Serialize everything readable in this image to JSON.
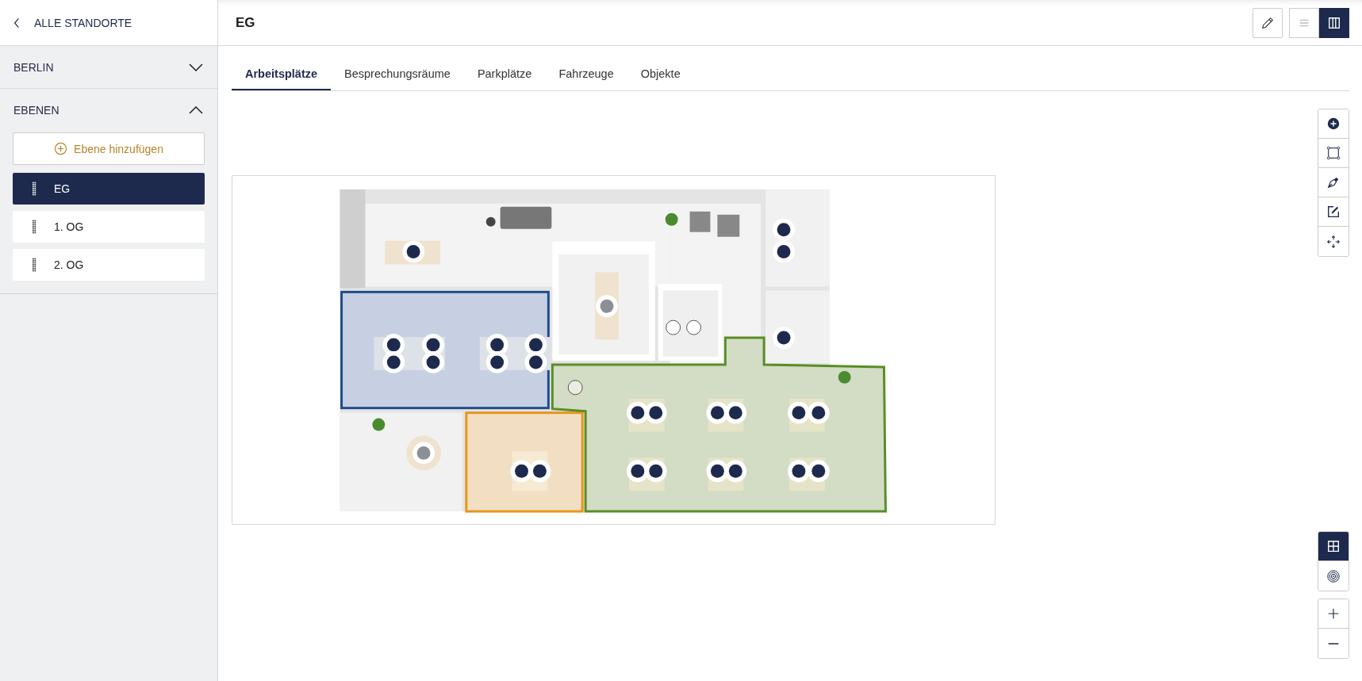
{
  "back_link": {
    "label": "ALLE STANDORTE"
  },
  "sections": [
    {
      "label": "BERLIN",
      "expanded": false
    },
    {
      "label": "EBENEN",
      "expanded": true,
      "add_button": "Ebene hinzufügen",
      "levels": [
        {
          "label": "EG",
          "selected": true
        },
        {
          "label": "1. OG",
          "selected": false
        },
        {
          "label": "2. OG",
          "selected": false
        }
      ]
    }
  ],
  "header": {
    "title": "EG"
  },
  "view_toggle": [
    {
      "kind": "list",
      "selected": false
    },
    {
      "kind": "map",
      "selected": true
    }
  ],
  "tabs": [
    {
      "label": "Arbeitsplätze",
      "selected": true
    },
    {
      "label": "Besprechungsräume",
      "selected": false
    },
    {
      "label": "Parkplätze",
      "selected": false
    },
    {
      "label": "Fahrzeuge",
      "selected": false
    },
    {
      "label": "Objekte",
      "selected": false
    }
  ],
  "map_layers": [
    {
      "kind": "grid",
      "selected": true
    },
    {
      "kind": "target",
      "selected": false
    }
  ]
}
